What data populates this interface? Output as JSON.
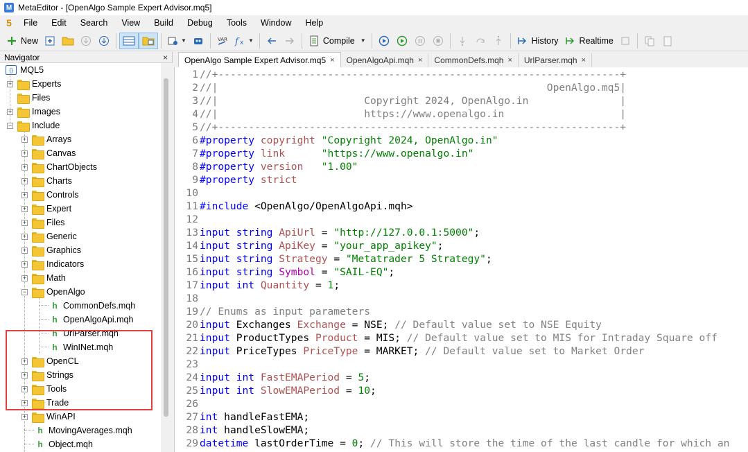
{
  "window": {
    "title": "MetaEditor - [OpenAlgo Sample Expert Advisor.mq5]",
    "logo": "5"
  },
  "menu": [
    "File",
    "Edit",
    "Search",
    "View",
    "Build",
    "Debug",
    "Tools",
    "Window",
    "Help"
  ],
  "toolbar": {
    "new_label": "New",
    "compile_label": "Compile",
    "history_label": "History",
    "realtime_label": "Realtime"
  },
  "navigator": {
    "title": "Navigator",
    "close": "×",
    "root": "MQL5",
    "top_folders": [
      "Experts",
      "Files",
      "Images",
      "Include"
    ],
    "include_folders_a": [
      "Arrays",
      "Canvas",
      "ChartObjects",
      "Charts",
      "Controls",
      "Expert",
      "Files",
      "Generic",
      "Graphics",
      "Indicators",
      "Math"
    ],
    "openalgo_folder": "OpenAlgo",
    "openalgo_files": [
      "CommonDefs.mqh",
      "OpenAlgoApi.mqh",
      "UrlParser.mqh",
      "WinINet.mqh"
    ],
    "include_folders_b": [
      "OpenCL",
      "Strings",
      "Tools",
      "Trade",
      "WinAPI"
    ],
    "include_files": [
      "MovingAverages.mqh",
      "Object.mqh"
    ]
  },
  "tabs": [
    {
      "label": "OpenAlgo Sample Expert Advisor.mq5",
      "close": "×"
    },
    {
      "label": "OpenAlgoApi.mqh",
      "close": "×"
    },
    {
      "label": "CommonDefs.mqh",
      "close": "×"
    },
    {
      "label": "UrlParser.mqh",
      "close": "×"
    }
  ],
  "code_lines": [
    {
      "n": "1",
      "parts": [
        {
          "t": "//+------------------------------------------------------------------+",
          "c": "comment"
        }
      ]
    },
    {
      "n": "2",
      "parts": [
        {
          "t": "//|                                                      OpenAlgo.mq5|",
          "c": "comment"
        }
      ]
    },
    {
      "n": "3",
      "parts": [
        {
          "t": "//|                        Copyright 2024, OpenAlgo.in               |",
          "c": "comment"
        }
      ]
    },
    {
      "n": "4",
      "parts": [
        {
          "t": "//|                        https://www.openalgo.in                   |",
          "c": "comment"
        }
      ]
    },
    {
      "n": "5",
      "parts": [
        {
          "t": "//+------------------------------------------------------------------+",
          "c": "comment"
        }
      ]
    },
    {
      "n": "6",
      "parts": [
        {
          "t": "#property ",
          "c": "kw"
        },
        {
          "t": "copyright ",
          "c": "prop"
        },
        {
          "t": "\"Copyright 2024, OpenAlgo.in\"",
          "c": "str"
        }
      ]
    },
    {
      "n": "7",
      "parts": [
        {
          "t": "#property ",
          "c": "kw"
        },
        {
          "t": "link      ",
          "c": "prop"
        },
        {
          "t": "\"https://www.openalgo.in\"",
          "c": "str"
        }
      ]
    },
    {
      "n": "8",
      "parts": [
        {
          "t": "#property ",
          "c": "kw"
        },
        {
          "t": "version   ",
          "c": "prop"
        },
        {
          "t": "\"1.00\"",
          "c": "str"
        }
      ]
    },
    {
      "n": "9",
      "parts": [
        {
          "t": "#property ",
          "c": "kw"
        },
        {
          "t": "strict",
          "c": "prop"
        }
      ]
    },
    {
      "n": "10",
      "parts": []
    },
    {
      "n": "11",
      "parts": [
        {
          "t": "#include ",
          "c": "kw"
        },
        {
          "t": "<OpenAlgo/OpenAlgoApi.mqh>",
          "c": "plain"
        }
      ]
    },
    {
      "n": "12",
      "parts": []
    },
    {
      "n": "13",
      "parts": [
        {
          "t": "input string ",
          "c": "kw"
        },
        {
          "t": "ApiUrl",
          "c": "prop"
        },
        {
          "t": " = ",
          "c": "plain"
        },
        {
          "t": "\"http://127.0.0.1:5000\"",
          "c": "str"
        },
        {
          "t": ";",
          "c": "plain"
        }
      ]
    },
    {
      "n": "14",
      "parts": [
        {
          "t": "input string ",
          "c": "kw"
        },
        {
          "t": "ApiKey",
          "c": "prop"
        },
        {
          "t": " = ",
          "c": "plain"
        },
        {
          "t": "\"your_app_apikey\"",
          "c": "str"
        },
        {
          "t": ";",
          "c": "plain"
        }
      ]
    },
    {
      "n": "15",
      "parts": [
        {
          "t": "input string ",
          "c": "kw"
        },
        {
          "t": "Strategy",
          "c": "prop"
        },
        {
          "t": " = ",
          "c": "plain"
        },
        {
          "t": "\"Metatrader 5 Strategy\"",
          "c": "str"
        },
        {
          "t": ";",
          "c": "plain"
        }
      ]
    },
    {
      "n": "16",
      "parts": [
        {
          "t": "input string ",
          "c": "kw"
        },
        {
          "t": "Symbol",
          "c": "var"
        },
        {
          "t": " = ",
          "c": "plain"
        },
        {
          "t": "\"SAIL-EQ\"",
          "c": "str"
        },
        {
          "t": ";",
          "c": "plain"
        }
      ]
    },
    {
      "n": "17",
      "parts": [
        {
          "t": "input int ",
          "c": "kw"
        },
        {
          "t": "Quantity",
          "c": "prop"
        },
        {
          "t": " = ",
          "c": "plain"
        },
        {
          "t": "1",
          "c": "num"
        },
        {
          "t": ";",
          "c": "plain"
        }
      ]
    },
    {
      "n": "18",
      "parts": []
    },
    {
      "n": "19",
      "parts": [
        {
          "t": "// Enums as input parameters",
          "c": "comment"
        }
      ]
    },
    {
      "n": "20",
      "parts": [
        {
          "t": "input ",
          "c": "kw"
        },
        {
          "t": "Exchanges ",
          "c": "plain"
        },
        {
          "t": "Exchange",
          "c": "prop"
        },
        {
          "t": " = NSE; ",
          "c": "plain"
        },
        {
          "t": "// Default value set to NSE Equity",
          "c": "comment"
        }
      ]
    },
    {
      "n": "21",
      "parts": [
        {
          "t": "input ",
          "c": "kw"
        },
        {
          "t": "ProductTypes ",
          "c": "plain"
        },
        {
          "t": "Product",
          "c": "prop"
        },
        {
          "t": " = MIS; ",
          "c": "plain"
        },
        {
          "t": "// Default value set to MIS for Intraday Square off",
          "c": "comment"
        }
      ]
    },
    {
      "n": "22",
      "parts": [
        {
          "t": "input ",
          "c": "kw"
        },
        {
          "t": "PriceTypes ",
          "c": "plain"
        },
        {
          "t": "PriceType",
          "c": "prop"
        },
        {
          "t": " = MARKET; ",
          "c": "plain"
        },
        {
          "t": "// Default value set to Market Order",
          "c": "comment"
        }
      ]
    },
    {
      "n": "23",
      "parts": []
    },
    {
      "n": "24",
      "parts": [
        {
          "t": "input int ",
          "c": "kw"
        },
        {
          "t": "FastEMAPeriod",
          "c": "prop"
        },
        {
          "t": " = ",
          "c": "plain"
        },
        {
          "t": "5",
          "c": "num"
        },
        {
          "t": ";",
          "c": "plain"
        }
      ]
    },
    {
      "n": "25",
      "parts": [
        {
          "t": "input int ",
          "c": "kw"
        },
        {
          "t": "SlowEMAPeriod",
          "c": "prop"
        },
        {
          "t": " = ",
          "c": "plain"
        },
        {
          "t": "10",
          "c": "num"
        },
        {
          "t": ";",
          "c": "plain"
        }
      ]
    },
    {
      "n": "26",
      "parts": []
    },
    {
      "n": "27",
      "parts": [
        {
          "t": "int ",
          "c": "kw"
        },
        {
          "t": "handleFastEMA;",
          "c": "plain"
        }
      ]
    },
    {
      "n": "28",
      "parts": [
        {
          "t": "int ",
          "c": "kw"
        },
        {
          "t": "handleSlowEMA;",
          "c": "plain"
        }
      ]
    },
    {
      "n": "29",
      "parts": [
        {
          "t": "datetime ",
          "c": "kw"
        },
        {
          "t": "lastOrderTime = ",
          "c": "plain"
        },
        {
          "t": "0",
          "c": "num"
        },
        {
          "t": "; ",
          "c": "plain"
        },
        {
          "t": "// This will store the time of the last candle for which an",
          "c": "comment"
        }
      ]
    }
  ]
}
